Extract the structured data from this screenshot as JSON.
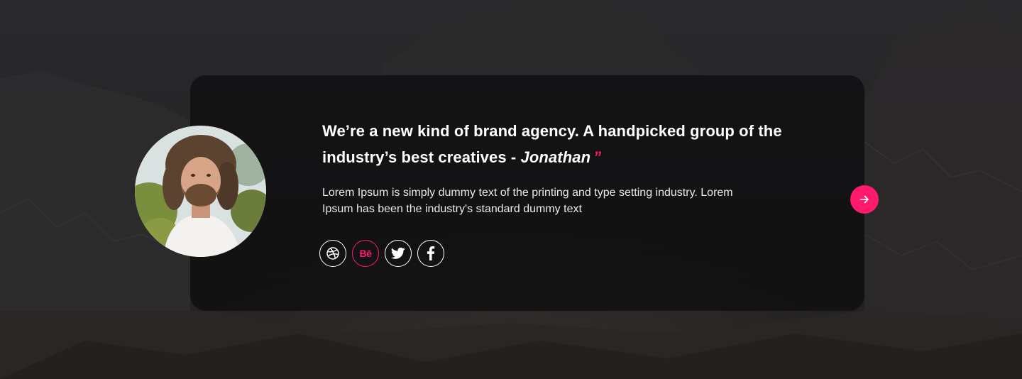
{
  "testimonial": {
    "quote_text": "We’re a new kind of brand agency. A handpicked group of the industry’s best creatives - ",
    "author": "Jonathan",
    "quote_mark": "”",
    "description": "Lorem Ipsum is simply dummy text of the printing and type setting industry. Lorem Ipsum has been the industry's standard dummy text"
  },
  "social_links": {
    "behance_label": "Bē"
  },
  "icons": {
    "avatar": "avatar-photo",
    "next": "arrow-right-icon",
    "dribbble": "dribbble-icon",
    "behance": "behance-icon",
    "twitter": "twitter-icon",
    "facebook": "facebook-icon"
  },
  "colors": {
    "accent": "#ff1a6e",
    "text": "#ffffff",
    "card_background": "#0c0c0e",
    "page_background": "#1c1b1d"
  }
}
